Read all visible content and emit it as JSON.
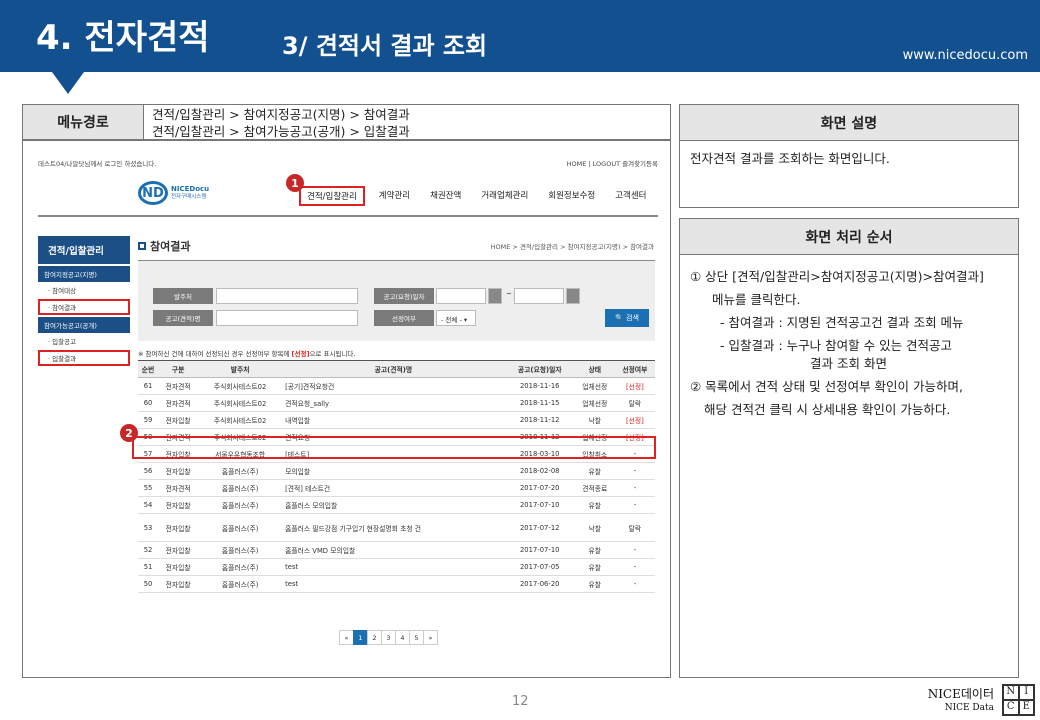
{
  "header": {
    "title": "4. 전자견적",
    "subtitle": "3/ 견적서 결과 조회",
    "url": "www.nicedocu.com"
  },
  "menu_path": {
    "label": "메뉴경로",
    "line1": "견적/입찰관리 > 참여지정공고(지명) > 참여결과",
    "line2": "견적/입찰관리 > 참여가능공고(공개) > 입찰결과"
  },
  "desc": {
    "title": "화면 설명",
    "text": "전자견적 결과를 조회하는 화면입니다."
  },
  "process": {
    "title": "화면 처리 순서",
    "s1": "① 상단 [견적/입찰관리>참여지정공고(지명)>참여결과]",
    "s1b": "메뉴를 클릭한다.",
    "s1c": "- 참여결과 : 지명된 견적공고건 결과 조회 메뉴",
    "s1d": "- 입찰결과 : 누구나 참여할 수 있는 견적공고",
    "s1e": "결과 조회 화면",
    "s2": "② 목록에서 견적 상태 및 선정여부 확인이 가능하며,",
    "s2b": "해당 견적건 클릭 시 상세내용 확인이 가능하다."
  },
  "inner": {
    "topleft": "데스트04/나알닷님께서 로그인 하셨습니다.",
    "topright": "HOME | LOGOUT 즐겨찾기등록",
    "logo_mark": "ND",
    "logo_text": "NICEDocu",
    "logo_sub": "전자구매시스템",
    "gnb": [
      "견적/입찰관리",
      "계약관리",
      "채권잔액",
      "거래업체관리",
      "회원정보수정",
      "고객센터"
    ],
    "lnb_title": "견적/입찰관리",
    "lnb_s1": "참여지정공고(지명)",
    "lnb_i1": "· 참여대상",
    "lnb_i2": "· 참여결과",
    "lnb_s2": "참여가능공고(공개)",
    "lnb_i3": "· 입찰공고",
    "lnb_i4": "· 입찰결과",
    "page_title": "참여결과",
    "breadcrumb": "HOME > 견적/입찰관리 > 참여지정공고(지명) > 참여결과",
    "f_orderer": "발주처",
    "f_date": "공고(요청)일자",
    "f_name": "공고(견적)명",
    "f_sel": "선정여부",
    "f_sel_val": "- 전체 -  ▾",
    "date_sep": "~",
    "btn_search": "🔍 검색",
    "note_pre": "※ 참여하신 건에 대하여 선정되신 경우 선정여부 항목에 ",
    "note_tag": "[선정]",
    "note_post": "으로 표시됩니다.",
    "cols": [
      "순번",
      "구분",
      "발주처",
      "공고(견적)명",
      "공고(요청)일자",
      "상태",
      "선정여부"
    ],
    "rows": [
      [
        "61",
        "전자견적",
        "주식회사테스트02",
        "[공기]견적요청건",
        "2018-11-16",
        "업체선정",
        "[선정]"
      ],
      [
        "60",
        "전자견적",
        "주식회사테스트02",
        "견적요청_sally",
        "2018-11-15",
        "업체선정",
        "탈락"
      ],
      [
        "59",
        "전자입찰",
        "주식회사테스트02",
        "내역입찰",
        "2018-11-12",
        "낙찰",
        "[선정]"
      ],
      [
        "58",
        "전자견적",
        "주식회사테스트02",
        "견적요청",
        "2018-11-12",
        "업체선정",
        "[선정]"
      ],
      [
        "57",
        "전자입찰",
        "서울우유협동조합",
        "[테스트]",
        "2018-03-10",
        "입찰취소",
        "-"
      ],
      [
        "56",
        "전자입찰",
        "홈플러스(주)",
        "모의입찰",
        "2018-02-08",
        "유찰",
        "-"
      ],
      [
        "55",
        "전자견적",
        "홈플러스(주)",
        "[견적] 테스트건",
        "2017-07-20",
        "견적종료",
        "-"
      ],
      [
        "54",
        "전자입찰",
        "홈플러스(주)",
        "홈플러스 모의입찰",
        "2017-07-10",
        "유찰",
        "-"
      ],
      [
        "53",
        "전자입찰",
        "홈플러스(주)",
        "홈플러스 필드강점 기구입기 현장설명회 초청 건",
        "2017-07-12",
        "낙찰",
        "탈락"
      ],
      [
        "52",
        "전자입찰",
        "홈플러스(주)",
        "홈플러스 VMD 모의입찰",
        "2017-07-10",
        "유찰",
        "-"
      ],
      [
        "51",
        "전자입찰",
        "홈플러스(주)",
        "test",
        "2017-07-05",
        "유찰",
        "-"
      ],
      [
        "50",
        "전자입찰",
        "홈플러스(주)",
        "test",
        "2017-06-20",
        "유찰",
        "-"
      ]
    ],
    "pages": [
      "«",
      "1",
      "2",
      "3",
      "4",
      "5",
      "»"
    ]
  },
  "badge1": "1",
  "badge2": "2",
  "page_number": "12",
  "brand": {
    "name": "NICE데이터",
    "sub": "NICE Data",
    "logo": [
      "N",
      "I",
      "C",
      "E"
    ]
  }
}
